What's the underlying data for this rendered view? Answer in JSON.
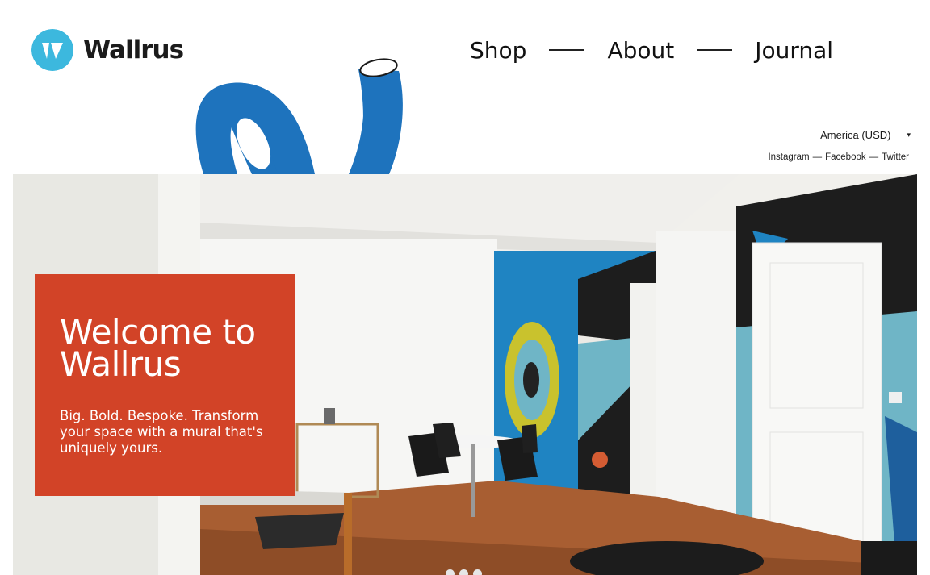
{
  "brand": {
    "name": "Wallrus",
    "logo_color": "#3cb8de"
  },
  "nav": {
    "items": [
      {
        "label": "Shop"
      },
      {
        "label": "About"
      },
      {
        "label": "Journal"
      }
    ]
  },
  "currency": {
    "selected": "America (USD)",
    "caret": "▾"
  },
  "social": {
    "links": [
      "Instagram",
      "Facebook",
      "Twitter"
    ],
    "separator": "—"
  },
  "hero": {
    "title_line1": "Welcome to",
    "title_line2": "Wallrus",
    "tagline": "Big. Bold. Bespoke. Transform your space with a mural that's uniquely yours.",
    "panel_color": "#d24327",
    "accent_blue": "#1e73bd"
  },
  "carousel": {
    "slide_count": 3
  }
}
